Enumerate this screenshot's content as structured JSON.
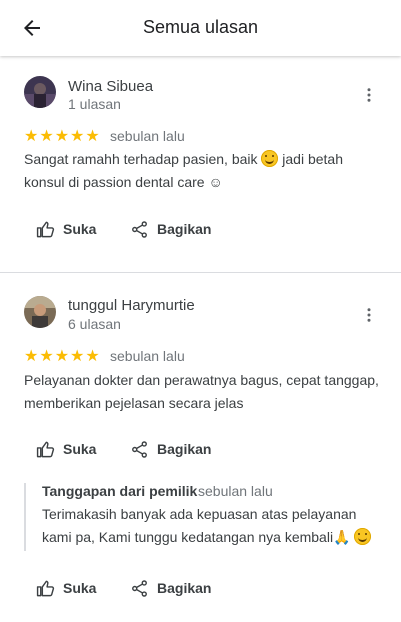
{
  "header": {
    "title": "Semua ulasan"
  },
  "reviews": [
    {
      "name": "Wina Sibuea",
      "count": "1 ulasan",
      "stars": "★★★★★",
      "rating": 5,
      "date": "sebulan lalu",
      "text": "Sangat ramahh terhadap pasien, baik",
      "text_after": "jadi betah konsul di passion dental care ☺",
      "like_label": "Suka",
      "share_label": "Bagikan"
    },
    {
      "name": "tunggul Harymurtie",
      "count": "6 ulasan",
      "stars": "★★★★★",
      "rating": 5,
      "date": "sebulan lalu",
      "text": "Pelayanan dokter dan perawatnya bagus, cepat tanggap, memberikan pejelasan secara jelas",
      "like_label": "Suka",
      "share_label": "Bagikan",
      "owner_reply": {
        "label": "Tanggapan dari pemilik",
        "date": "sebulan lalu",
        "text": "Terimakasih banyak ada kepuasan atas pelayanan kami pa, Kami tunggu kedatangan nya kembali🙏",
        "like_label": "Suka",
        "share_label": "Bagikan"
      }
    }
  ],
  "colors": {
    "star": "#fbbc04",
    "divider": "#dadce0",
    "text": "#3c4043",
    "muted": "#70757a"
  }
}
